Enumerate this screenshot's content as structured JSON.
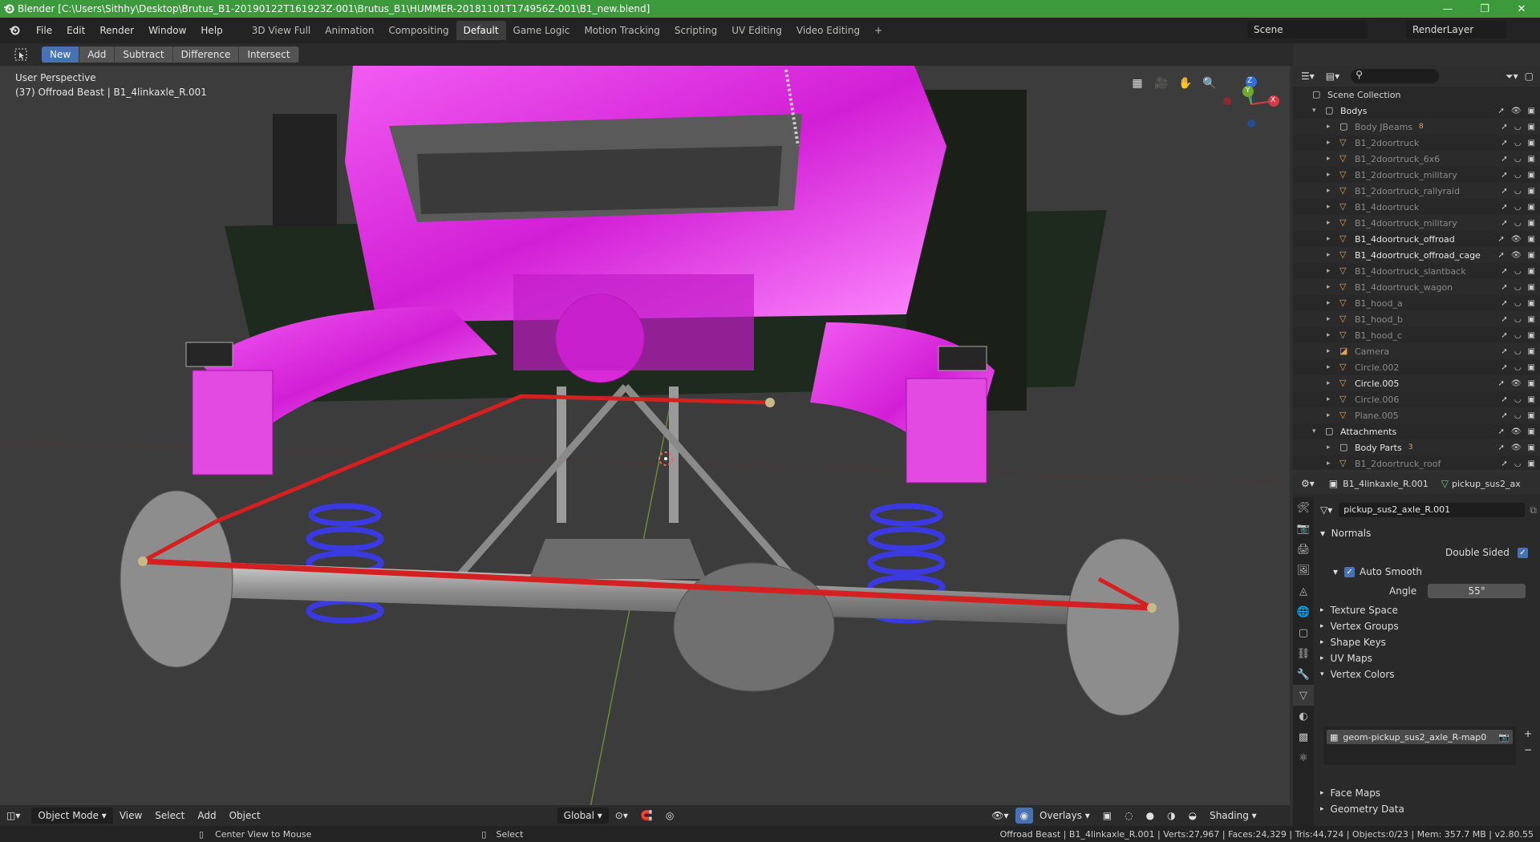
{
  "window": {
    "title": "Blender [C:\\Users\\Sithhy\\Desktop\\Brutus_B1-20190122T161923Z-001\\Brutus_B1\\HUMMER-20181101T174956Z-001\\B1_new.blend]",
    "minimize": "—",
    "maximize": "❐",
    "close": "✕"
  },
  "menu": [
    "File",
    "Edit",
    "Render",
    "Window",
    "Help"
  ],
  "workspaces": [
    "3D View Full",
    "Animation",
    "Compositing",
    "Default",
    "Game Logic",
    "Motion Tracking",
    "Scripting",
    "UV Editing",
    "Video Editing"
  ],
  "active_workspace": "Default",
  "add_workspace": "+",
  "scene": {
    "name": "Scene",
    "layer": "RenderLayer"
  },
  "boolean_tools": {
    "new": "New",
    "add": "Add",
    "subtract": "Subtract",
    "difference": "Difference",
    "intersect": "Intersect"
  },
  "viewport": {
    "perspective": "User Perspective",
    "object_info": "(37) Offroad Beast | B1_4linkaxle_R.001",
    "axis_x": "X",
    "axis_y": "Y",
    "axis_z": "Z"
  },
  "header3d": {
    "mode": "Object Mode",
    "view": "View",
    "select": "Select",
    "add": "Add",
    "object": "Object",
    "orientation": "Global",
    "overlays": "Overlays",
    "shading": "Shading"
  },
  "status": {
    "left_action": "Center View to Mouse",
    "right_action": "Select",
    "info": "Offroad Beast | B1_4linkaxle_R.001 | Verts:27,967 | Faces:24,329 | Tris:44,724 | Objects:0/23 | Mem: 357.7 MB | v2.80.55"
  },
  "outliner": {
    "root": "Scene Collection",
    "items": [
      {
        "name": "Bodys",
        "type": "collection",
        "indent": 0,
        "bright": true,
        "expanded": true
      },
      {
        "name": "Body JBeams",
        "type": "collection",
        "indent": 1,
        "bright": false,
        "badge": "8"
      },
      {
        "name": "B1_2doortruck",
        "type": "mesh",
        "indent": 1,
        "bright": false
      },
      {
        "name": "B1_2doortruck_6x6",
        "type": "mesh",
        "indent": 1,
        "bright": false
      },
      {
        "name": "B1_2doortruck_military",
        "type": "mesh",
        "indent": 1,
        "bright": false
      },
      {
        "name": "B1_2doortruck_rallyraid",
        "type": "mesh",
        "indent": 1,
        "bright": false
      },
      {
        "name": "B1_4doortruck",
        "type": "mesh",
        "indent": 1,
        "bright": false
      },
      {
        "name": "B1_4doortruck_military",
        "type": "mesh",
        "indent": 1,
        "bright": false
      },
      {
        "name": "B1_4doortruck_offroad",
        "type": "mesh",
        "indent": 1,
        "bright": true
      },
      {
        "name": "B1_4doortruck_offroad_cage",
        "type": "mesh",
        "indent": 1,
        "bright": true
      },
      {
        "name": "B1_4doortruck_slantback",
        "type": "mesh",
        "indent": 1,
        "bright": false
      },
      {
        "name": "B1_4doortruck_wagon",
        "type": "mesh",
        "indent": 1,
        "bright": false
      },
      {
        "name": "B1_hood_a",
        "type": "mesh",
        "indent": 1,
        "bright": false
      },
      {
        "name": "B1_hood_b",
        "type": "mesh",
        "indent": 1,
        "bright": false
      },
      {
        "name": "B1_hood_c",
        "type": "mesh",
        "indent": 1,
        "bright": false
      },
      {
        "name": "Camera",
        "type": "camera",
        "indent": 1,
        "bright": false
      },
      {
        "name": "Circle.002",
        "type": "mesh",
        "indent": 1,
        "bright": false
      },
      {
        "name": "Circle.005",
        "type": "mesh",
        "indent": 1,
        "bright": true
      },
      {
        "name": "Circle.006",
        "type": "mesh",
        "indent": 1,
        "bright": false
      },
      {
        "name": "Plane.005",
        "type": "mesh",
        "indent": 1,
        "bright": false
      },
      {
        "name": "Attachments",
        "type": "collection",
        "indent": 0,
        "bright": true,
        "expanded": true
      },
      {
        "name": "Body Parts",
        "type": "collection",
        "indent": 1,
        "bright": true,
        "badge": "3"
      },
      {
        "name": "B1_2doortruck_roof",
        "type": "mesh",
        "indent": 1,
        "bright": false
      }
    ]
  },
  "properties": {
    "object": "B1_4linkaxle_R.001",
    "mesh_name": "pickup_sus2_ax",
    "data_name": "pickup_sus2_axle_R.001",
    "normals": "Normals",
    "double_sided": "Double Sided",
    "auto_smooth": "Auto Smooth",
    "angle_label": "Angle",
    "angle_value": "55°",
    "sections": [
      "Texture Space",
      "Vertex Groups",
      "Shape Keys",
      "UV Maps",
      "Vertex Colors"
    ],
    "vertex_color_layer": "geom-pickup_sus2_axle_R-map0",
    "sections2": [
      "Face Maps",
      "Geometry Data"
    ]
  },
  "colors": {
    "accent": "#4772b3",
    "title_bar": "#3c9a3c",
    "magenta": "#e633e6",
    "red_rod": "#d42020",
    "spring": "#3a3ae0"
  }
}
